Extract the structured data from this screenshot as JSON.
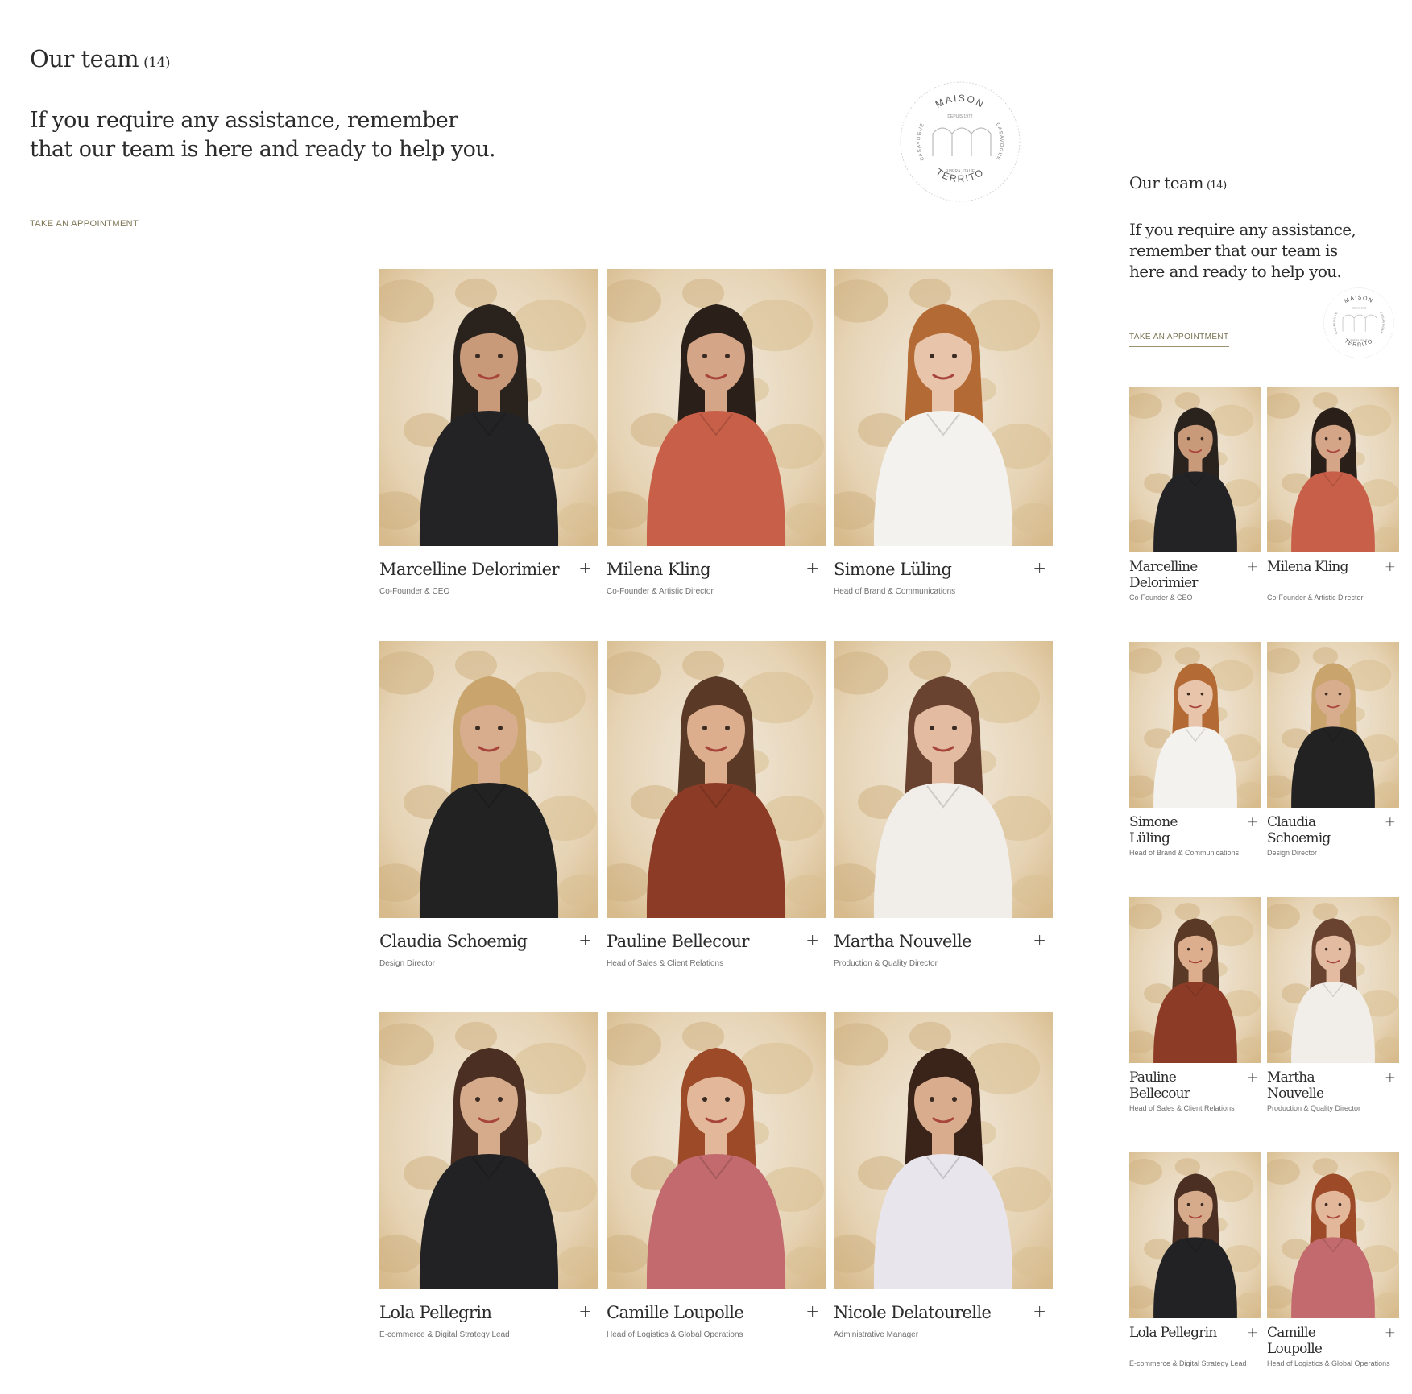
{
  "desktop": {
    "title": "Our team",
    "count": "(14)",
    "intro": "If you require any assistance, remember that our team is here and ready to help you.",
    "cta": "TAKE AN APPOINTMENT"
  },
  "mobile": {
    "title": "Our team",
    "count": "(14)",
    "intro": "If you require any assistance, remember that our team is here and ready to help you.",
    "cta": "TAKE AN APPOINTMENT"
  },
  "seal": {
    "top": "MAISON",
    "bottom": "TERRITO",
    "left": "CASAVOGUE",
    "right": "CASAVOGUE",
    "since": "DEPUIS 1972",
    "place": "RIBERA, ITALIE"
  },
  "plus_glyph": "+",
  "team": [
    {
      "name": "Marcelline Delorimier",
      "role": "Co-Founder & CEO",
      "hair": "#2a221c",
      "top": "#232326",
      "skin": "#c99a7a"
    },
    {
      "name": "Milena Kling",
      "role": "Co-Founder & Artistic Director",
      "hair": "#2b2019",
      "top": "#c85f48",
      "skin": "#d4a587"
    },
    {
      "name": "Simone Lüling",
      "role": "Head of Brand & Communications",
      "hair": "#b46a35",
      "top": "#f4f2ee",
      "skin": "#e7c4aa"
    },
    {
      "name": "Claudia Schoemig",
      "role": "Design Director",
      "hair": "#c9a46d",
      "top": "#232222",
      "skin": "#d8ad8d"
    },
    {
      "name": "Pauline Bellecour",
      "role": "Head of Sales & Client Relations",
      "hair": "#5a3a26",
      "top": "#8c3c26",
      "skin": "#dcae8d"
    },
    {
      "name": "Martha Nouvelle",
      "role": "Production & Quality Director",
      "hair": "#6a4330",
      "top": "#f1eeea",
      "skin": "#e2bba0"
    },
    {
      "name": "Lola Pellegrin",
      "role": "E-commerce & Digital Strategy Lead",
      "hair": "#4b2f22",
      "top": "#222224",
      "skin": "#d6ab8c"
    },
    {
      "name": "Camille Loupolle",
      "role": "Head of Logistics & Global Operations",
      "hair": "#9c4a28",
      "top": "#c26a6e",
      "skin": "#e2b79a"
    },
    {
      "name": "Nicole Delatourelle",
      "role": "Administrative Manager",
      "hair": "#3a241a",
      "top": "#e8e6ec",
      "skin": "#d9ac8e"
    }
  ],
  "mobile_order": [
    0,
    1,
    2,
    3,
    4,
    5,
    6,
    7
  ]
}
